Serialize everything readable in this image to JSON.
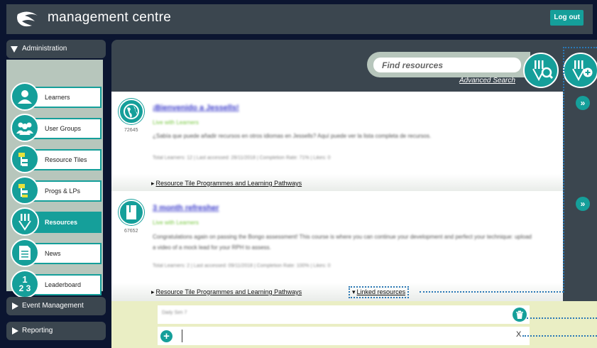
{
  "header": {
    "app_title": "management centre",
    "logout_label": "Log out"
  },
  "sidebar": {
    "admin_label": "Administration",
    "items": [
      {
        "label": "Learners",
        "icon": "person-icon"
      },
      {
        "label": "User Groups",
        "icon": "group-icon"
      },
      {
        "label": "Resource Tiles",
        "icon": "folder-tree-icon"
      },
      {
        "label": "Progs & LPs",
        "icon": "folder-tree-icon"
      },
      {
        "label": "Resources",
        "icon": "resources-icon",
        "active": true
      },
      {
        "label": "News",
        "icon": "news-icon"
      },
      {
        "label": "Leaderboard",
        "icon": "leaderboard-icon",
        "glyph_top": "1",
        "glyph_bottom": "2 3"
      }
    ],
    "event_label": "Event Management",
    "reporting_label": "Reporting"
  },
  "search": {
    "placeholder": "Find resources",
    "advanced_label": "Advanced Search"
  },
  "resources": [
    {
      "id": "72645",
      "title": "¡Bienvenido a Jessells!",
      "subtitle": "Live with Learners",
      "description": "¿Sabía que puede añadir recursos en otros idiomas en Jessells? Aquí puede ver la lista completa de recursos.",
      "meta": "Total Learners: 12 | Last accessed: 28/11/2018 | Completion Rate: 71% | Likes: 0",
      "footer_link": "Resource Tile Programmes and Learning Pathways"
    },
    {
      "id": "67652",
      "title": "3 month refresher",
      "subtitle": "Live with Learners",
      "description": "Congratulations again on passing the Bongo assessment! This course is where you can continue your development and perfect your technique: upload a video of a mock lead for your RPH to assess.",
      "meta": "Total Learners: 2 | Last accessed: 09/11/2018 | Completion Rate: 100% | Likes: 0",
      "footer_link": "Resource Tile Programmes and Learning Pathways",
      "linked_label": "Linked resources"
    }
  ],
  "linked": {
    "item_text": "Daily Sim 7",
    "clear_label": "X"
  },
  "colors": {
    "accent": "#159f9a",
    "dark": "#3b464f",
    "panel": "#b7c6bc"
  }
}
